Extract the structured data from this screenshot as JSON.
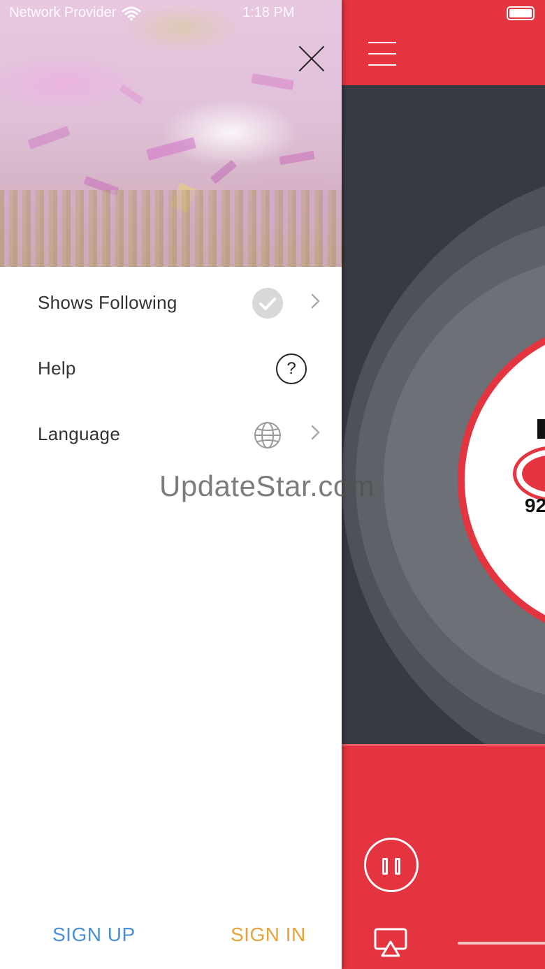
{
  "status_bar": {
    "carrier": "Network Provider",
    "time": "1:18 PM"
  },
  "drawer": {
    "menu_items": [
      {
        "label": "Shows Following",
        "icon": "check-circle-icon",
        "has_chevron": true
      },
      {
        "label": "Help",
        "icon": "help-circle-icon",
        "has_chevron": false
      },
      {
        "label": "Language",
        "icon": "globe-icon",
        "has_chevron": true
      }
    ],
    "help_icon_glyph": "?",
    "signup_label": "SIGN UP",
    "signin_label": "SIGN IN"
  },
  "player": {
    "station_frequency": "92"
  },
  "watermark": "UpdateStar.com",
  "colors": {
    "brand_red": "#e3343f",
    "signup_blue": "#4a90d9",
    "signin_orange": "#e8a23a"
  }
}
